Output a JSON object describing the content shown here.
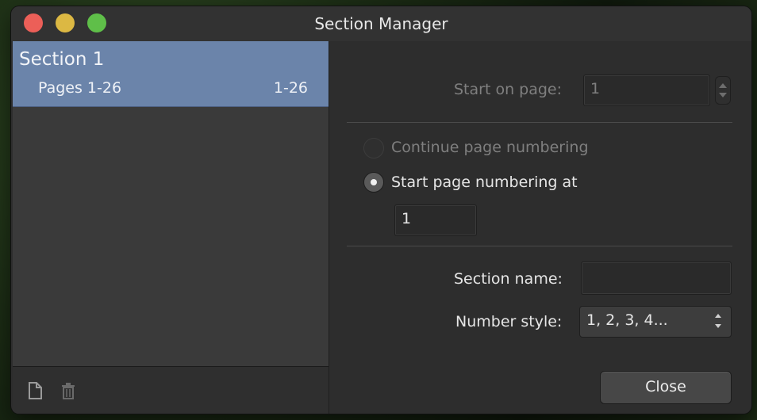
{
  "window": {
    "title": "Section Manager"
  },
  "sections": [
    {
      "name": "Section 1",
      "pages_label": "Pages 1-26",
      "range": "1-26"
    }
  ],
  "footer_icons": {
    "add": "new-page-icon",
    "delete": "trash-icon"
  },
  "settings": {
    "start_on_page_label": "Start on page:",
    "start_on_page_value": "1",
    "continue_numbering_label": "Continue page numbering",
    "start_numbering_at_label": "Start page numbering at",
    "start_numbering_at_value": "1",
    "section_name_label": "Section name:",
    "section_name_value": "",
    "number_style_label": "Number style:",
    "number_style_value": "1, 2, 3, 4..."
  },
  "buttons": {
    "close": "Close"
  }
}
